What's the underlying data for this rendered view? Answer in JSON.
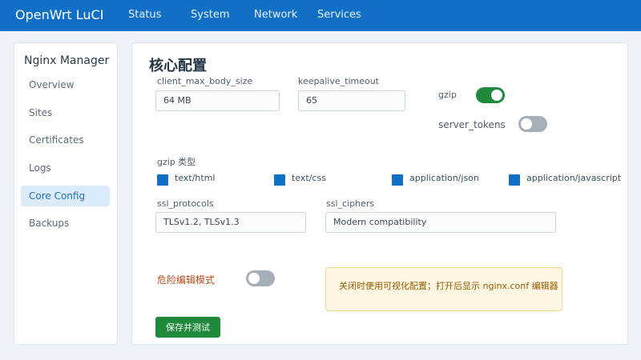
{
  "app": {
    "title": "OpenWrt LuCI"
  },
  "nav": {
    "items": [
      "Status",
      "System",
      "Network",
      "Services"
    ]
  },
  "sidebar": {
    "title": "Nginx Manager",
    "items": [
      "Overview",
      "Sites",
      "Certificates",
      "Logs",
      "Core Config",
      "Backups"
    ],
    "active": "Core Config"
  },
  "main": {
    "title": "核心配置",
    "fields": {
      "client_max_body_size": {
        "label": "client_max_body_size",
        "value": "64 MB"
      },
      "keepalive_timeout": {
        "label": "keepalive_timeout",
        "value": "65"
      },
      "ssl_protocols": {
        "label": "ssl_protocols",
        "value": "TLSv1.2, TLSv1.3"
      },
      "ssl_ciphers": {
        "label": "ssl_ciphers",
        "value": "Modern compatibility"
      }
    },
    "toggles": {
      "gzip": {
        "label": "gzip",
        "on": true
      },
      "server_tokens": {
        "label": "server_tokens",
        "on": false
      },
      "danger_mode": {
        "label": "危险编辑模式",
        "on": false
      }
    },
    "gzip_types": {
      "label": "gzip 类型",
      "items": [
        "text/html",
        "text/css",
        "application/json",
        "application/javascript"
      ]
    },
    "notice": "关闭时使用可视化配置；打开后显示 nginx.conf 编辑器",
    "save_label": "保存并测试"
  },
  "colors": {
    "topbar": "#1170c6",
    "checkbox": "#1170c6",
    "toggle_on": "#1f8a3c",
    "toggle_off": "#a6aeb8",
    "save": "#1f8a3c",
    "danger_text": "#b84a1c",
    "notice_bg": "#fdf6e3"
  }
}
